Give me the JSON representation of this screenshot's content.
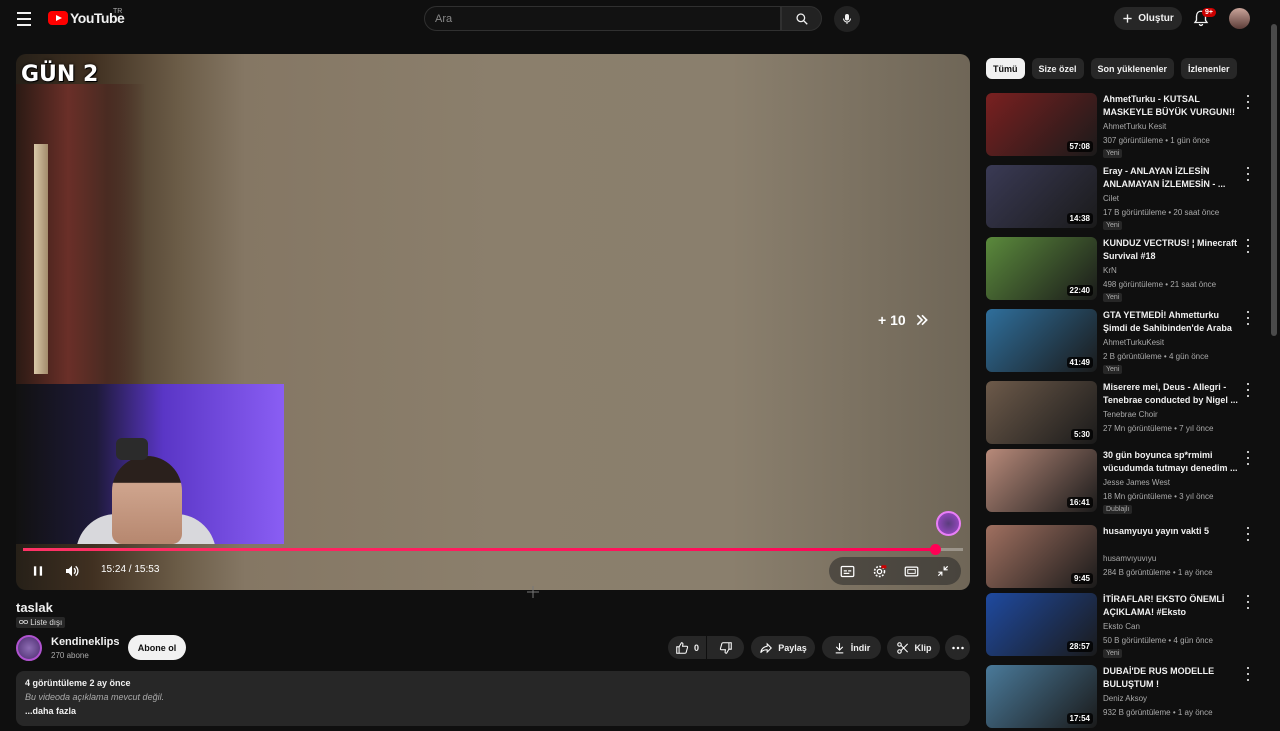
{
  "header": {
    "logo_text": "YouTube",
    "region": "TR",
    "search_placeholder": "Ara",
    "create_label": "Oluştur",
    "notification_count": "9+"
  },
  "player": {
    "overlay_label": "GÜN 2",
    "skip_label": "+ 10",
    "time_display": "15:24 / 15:53",
    "progress_fraction": 0.97
  },
  "video": {
    "title": "taslak",
    "visibility": "Liste dışı",
    "channel_name": "Kendineklips",
    "subscribers": "270 abone",
    "subscribe_label": "Abone ol",
    "like_count": "0",
    "share_label": "Paylaş",
    "download_label": "İndir",
    "clip_label": "Klip",
    "views_date": "4 görüntüleme  2 ay önce",
    "description": "Bu videoda açıklama mevcut değil.",
    "more_label": "...daha fazla"
  },
  "chips": [
    "Tümü",
    "Size özel",
    "Son yüklenenler",
    "İzlenenler"
  ],
  "recommendations": [
    {
      "title": "AhmetTurku - KUTSAL MASKEYLE BÜYÜK VURGUN!! |...",
      "channel": "AhmetTurku Kesit",
      "stats": "307 görüntüleme • 1 gün önce",
      "badge": "Yeni",
      "duration": "57:08",
      "thumb_color": "#7a2020"
    },
    {
      "title": "Eray - ANLAYAN İZLESİN ANLAMAYAN İZLEMESİN - ...",
      "channel": "Cilet",
      "stats": "17 B görüntüleme • 20 saat önce",
      "badge": "Yeni",
      "duration": "14:38",
      "thumb_color": "#3a3a55"
    },
    {
      "title": "KUNDUZ VECTRUS! ¦ Minecraft Survival #18",
      "channel": "KrN",
      "stats": "498 görüntüleme • 21 saat önce",
      "badge": "Yeni",
      "duration": "22:40",
      "thumb_color": "#5b8a3c"
    },
    {
      "title": "GTA YETMEDİ! Ahmetturku Şimdi de Sahibinden'de Araba ...",
      "channel": "AhmetTurkuKesit",
      "stats": "2 B görüntüleme • 4 gün önce",
      "badge": "Yeni",
      "duration": "41:49",
      "thumb_color": "#2f6f9c"
    },
    {
      "title": "Miserere mei, Deus - Allegri - Tenebrae conducted by Nigel ...",
      "channel": "Tenebrae Choir",
      "stats": "27 Mn görüntüleme • 7 yıl önce",
      "badge": "",
      "duration": "5:30",
      "thumb_color": "#6d5a4a"
    },
    {
      "title": "30 gün boyunca sp*rmimi vücudumda tutmayı denedim ...",
      "channel": "Jesse James West",
      "stats": "18 Mn görüntüleme • 3 yıl önce",
      "badge": "Dublajlı",
      "duration": "16:41",
      "thumb_color": "#b88a7a"
    },
    {
      "title": "husamyuyu yayın vakti 5",
      "channel": "husamvıyuvıyu",
      "stats": "284 B görüntüleme • 1 ay önce",
      "badge": "",
      "duration": "9:45",
      "thumb_color": "#a07060"
    },
    {
      "title": "İTİRAFLAR! EKSTO ÖNEMLİ AÇIKLAMA! #Eksto",
      "channel": "Ekstо Can",
      "stats": "50 B görüntüleme • 4 gün önce",
      "badge": "Yeni",
      "duration": "28:57",
      "thumb_color": "#1f4aa0"
    },
    {
      "title": "DUBAİ'DE RUS MODELLE BULUŞTUM !",
      "channel": "Deniz Aksoy",
      "stats": "932 B görüntüleme • 1 ay önce",
      "badge": "",
      "duration": "17:54",
      "thumb_color": "#4a7a9a"
    }
  ]
}
